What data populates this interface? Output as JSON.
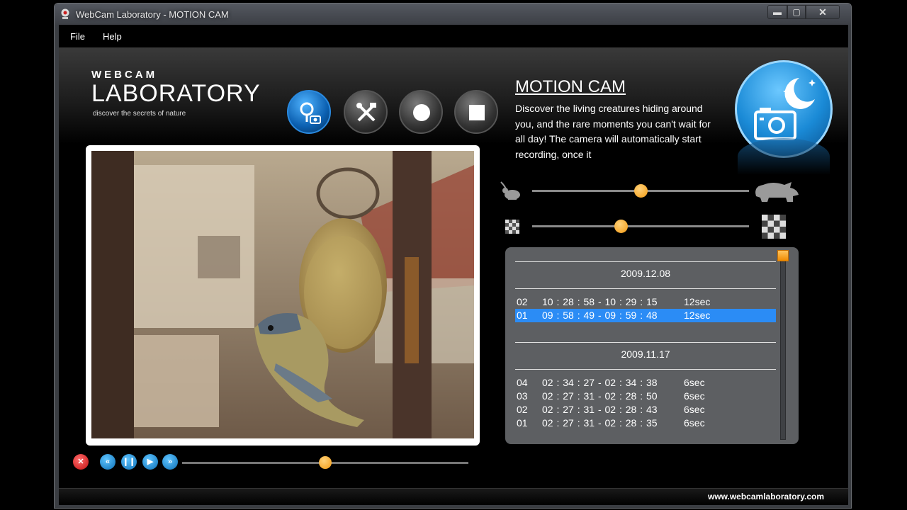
{
  "window": {
    "title": "WebCam Laboratory - MOTION CAM"
  },
  "menu": {
    "file": "File",
    "help": "Help"
  },
  "logo": {
    "top": "WEBCAM",
    "main": "LABORATORY",
    "tagline": "discover the secrets of nature"
  },
  "toolbar": {
    "icons": [
      "search-camera-icon",
      "tools-icon",
      "record-icon",
      "stop-icon"
    ]
  },
  "mode": {
    "title": "MOTION CAM",
    "description": "Discover the living creatures hiding around you, and the rare moments you can't wait for all day! The camera will automatically start recording, once it"
  },
  "sliders": {
    "sensitivity": {
      "value": 0.5,
      "low_icon": "mouse-icon",
      "high_icon": "rhino-icon"
    },
    "quality": {
      "value": 0.41,
      "low_icon": "small-checker-icon",
      "high_icon": "large-checker-icon"
    }
  },
  "playback": {
    "position": 0.5
  },
  "recordings": [
    {
      "date": "2009.12.08",
      "items": [
        {
          "num": "02",
          "time": "10 : 28 : 58 - 10 : 29 : 15",
          "duration": "12sec",
          "selected": false
        },
        {
          "num": "01",
          "time": "09 : 58 : 49 - 09 : 59 : 48",
          "duration": "12sec",
          "selected": true
        }
      ]
    },
    {
      "date": "2009.11.17",
      "items": [
        {
          "num": "04",
          "time": "02 : 34 : 27 - 02 : 34 : 38",
          "duration": "6sec",
          "selected": false
        },
        {
          "num": "03",
          "time": "02 : 27 : 31 - 02 : 28 : 50",
          "duration": "6sec",
          "selected": false
        },
        {
          "num": "02",
          "time": "02 : 27 : 31 - 02 : 28 : 43",
          "duration": "6sec",
          "selected": false
        },
        {
          "num": "01",
          "time": "02 : 27 : 31 - 02 : 28 : 35",
          "duration": "6sec",
          "selected": false
        }
      ]
    }
  ],
  "footer": {
    "url": "www.webcamlaboratory.com"
  },
  "colors": {
    "accent": "#f39a12",
    "selection": "#2b8cf5",
    "mode_blue": "#1a8ad6"
  }
}
